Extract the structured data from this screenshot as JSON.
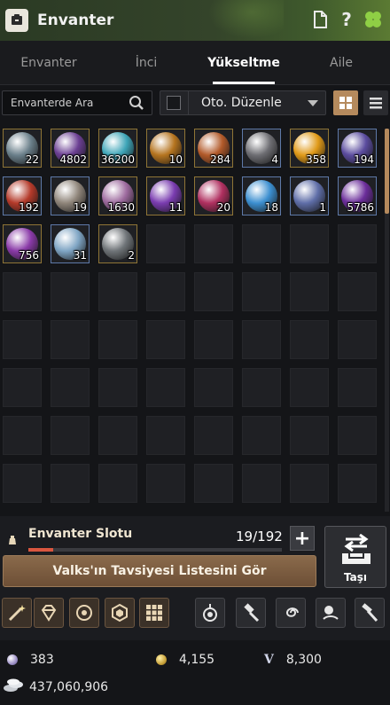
{
  "header": {
    "title": "Envanter"
  },
  "tabs": [
    {
      "label": "Envanter",
      "active": false
    },
    {
      "label": "İnci",
      "active": false
    },
    {
      "label": "Yükseltme",
      "active": true
    },
    {
      "label": "Aile",
      "active": false
    }
  ],
  "search": {
    "placeholder": "Envanterde Ara"
  },
  "sort": {
    "label": "Oto. Düzenle",
    "checked": false
  },
  "items": [
    {
      "count": "22",
      "color": "#6a7f8a"
    },
    {
      "count": "4802",
      "color": "#6b3f93"
    },
    {
      "count": "36200",
      "color": "#3ea5b8"
    },
    {
      "count": "10",
      "color": "#b5741f"
    },
    {
      "count": "284",
      "color": "#b25a2a"
    },
    {
      "count": "4",
      "color": "#6d6d72"
    },
    {
      "count": "358",
      "color": "#e09a18"
    },
    {
      "count": "194",
      "color": "#5b4c9e"
    },
    {
      "count": "192",
      "color": "#b43a2a"
    },
    {
      "count": "19",
      "color": "#8f857a"
    },
    {
      "count": "1630",
      "color": "#9d6a9e"
    },
    {
      "count": "11",
      "color": "#7a3cb0"
    },
    {
      "count": "20",
      "color": "#b03060"
    },
    {
      "count": "18",
      "color": "#3c8fd0"
    },
    {
      "count": "1",
      "color": "#5f6ea8"
    },
    {
      "count": "5786",
      "color": "#6b2d9a"
    },
    {
      "count": "756",
      "color": "#8a3aa8"
    },
    {
      "count": "31",
      "color": "#7fa5c4"
    },
    {
      "count": "2",
      "color": "#6f7478"
    }
  ],
  "slots": {
    "label": "Envanter Slotu",
    "used": "19",
    "separator": "/",
    "total": "192",
    "fill_ratio": 0.099
  },
  "valks_button": "Valks'ın Tavsiyesi Listesini Gör",
  "move_button": "Taşı",
  "currency": {
    "pearls": "383",
    "coins": "4,155",
    "v_label": "V",
    "v_value": "8,300",
    "silver": "437,060,906"
  },
  "colors": {
    "accent": "#b58a5d",
    "progress": "#d9563f"
  }
}
